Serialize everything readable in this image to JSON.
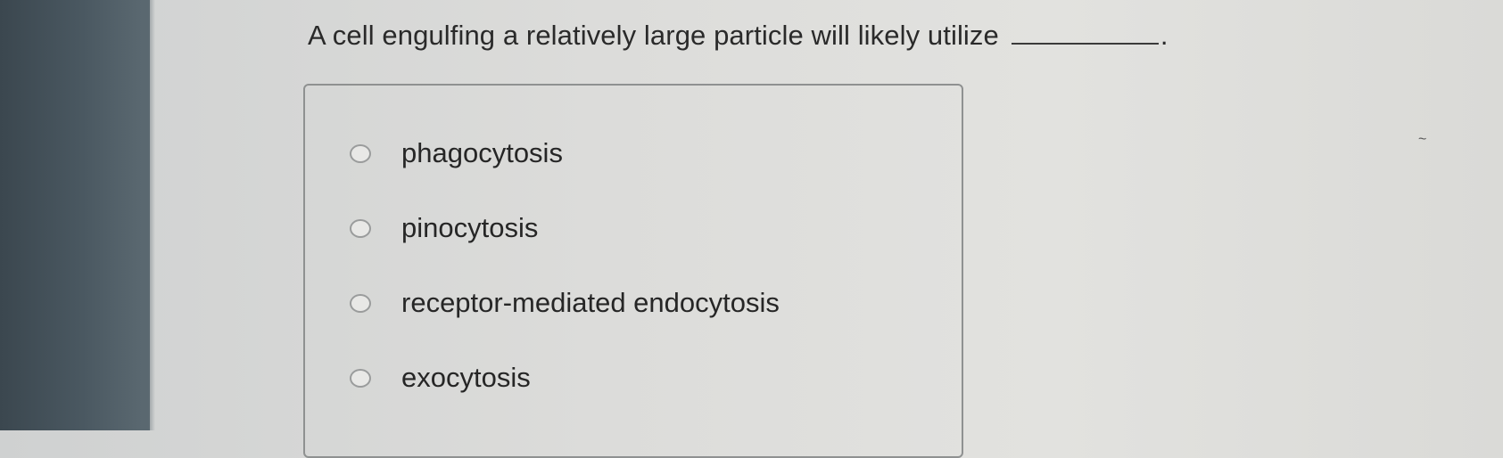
{
  "question": {
    "text": "A cell engulfing a relatively large particle will likely utilize",
    "trailing_punctuation": "."
  },
  "options": [
    {
      "label": "phagocytosis",
      "selected": false
    },
    {
      "label": "pinocytosis",
      "selected": false
    },
    {
      "label": "receptor-mediated endocytosis",
      "selected": false
    },
    {
      "label": "exocytosis",
      "selected": false
    }
  ],
  "colors": {
    "page_background": "#dcdcda",
    "bezel": "#4a5861",
    "text": "#2a2a2a",
    "box_border": "#8f9191"
  }
}
